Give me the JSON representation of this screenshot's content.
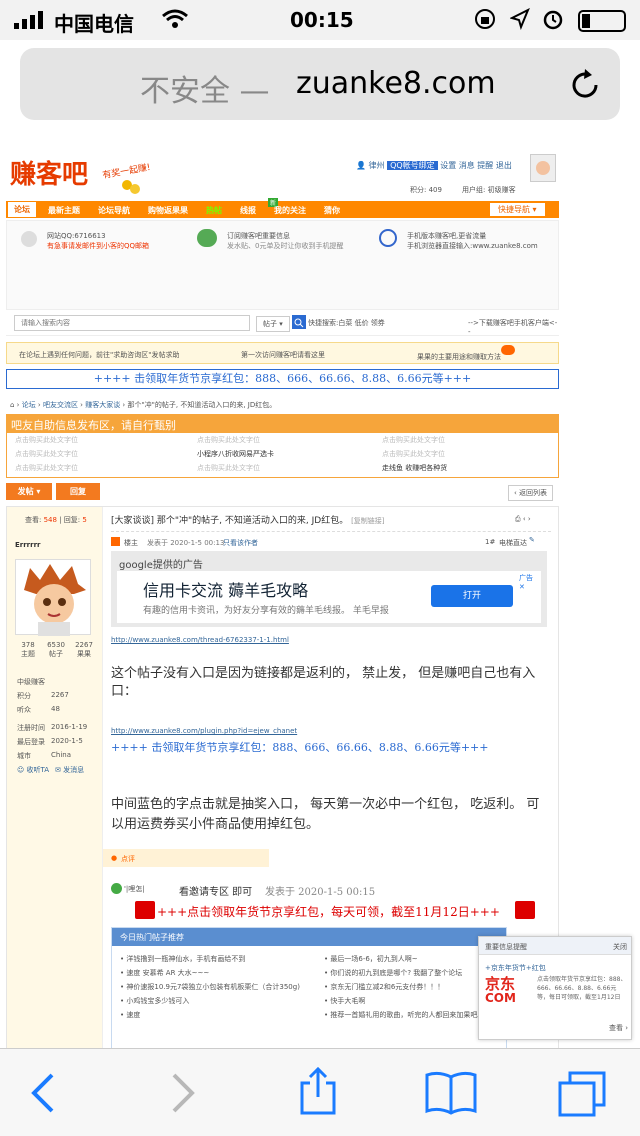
{
  "status": {
    "carrier": "中国电信",
    "time": "00:15"
  },
  "urlbar": {
    "insecure": "不安全 —",
    "domain": "zuanke8.com"
  },
  "site": {
    "logo": "赚客吧",
    "slogan": "有奖一起赚!",
    "user_links": [
      "律州",
      "QQ帐号绑定",
      "设置",
      "消息",
      "提醒",
      "退出"
    ],
    "points": "积分: 409",
    "user_group": "用户组: 初级赚客"
  },
  "nav": {
    "items": [
      "论坛",
      "最新主题",
      "论坛导航",
      "购物返果果",
      "热帖",
      "线报",
      "我的关注",
      "猜你"
    ],
    "badge": "新",
    "quick": "快捷导航"
  },
  "info": {
    "qq": "网站QQ:6716613",
    "qq_warn": "有急事请发邮件到小客的QQ邮箱",
    "wechat1": "订阅赚客吧重要信息",
    "wechat2": "发水贴、0元单及时让你收到手机提醒",
    "mobile1": "手机版本赚客吧,更省流量",
    "mobile2": "手机浏览器直接输入:www.zuanke8.com"
  },
  "search": {
    "placeholder": "请输入搜索内容",
    "type": "帖子",
    "hot": "快捷搜索:白菜 低价 领券",
    "app": "-->下载赚客吧手机客户端<--"
  },
  "notice": {
    "n1": "在论坛上遇到任何问题，前往\"求助咨询区\"发帖求助",
    "n2": "第一次访问赚客吧请看这里",
    "n3": "果果的主要用途和赚取方法"
  },
  "banner": "++++ 击领取年货节京享红包：888、666、66.66、8.88、6.66元等+++",
  "breadcrumb": [
    "论坛",
    "吧友交流区",
    "赚客大家谈",
    "那个\"冲\"的帖子,  不知道活动入口的来,  JD红包。"
  ],
  "adarea": {
    "title": "吧友自助信息发布区，请自行甄别",
    "placeholder": "点击购买此处文字位",
    "item1": "小程序八折收网易严选卡",
    "item2": "走线鱼 收赚吧各种货"
  },
  "buttons": {
    "post": "发帖",
    "reply": "回复",
    "back": "返回列表"
  },
  "thread": {
    "views_label": "查看:",
    "views": "548",
    "replies_label": "回复:",
    "replies": "5",
    "title": "[大家谈谈] 那个\"冲\"的帖子,  不知道活动入口的来,  JD红包。",
    "copy": "[复制链接]",
    "op_tag": "楼主",
    "posted": "发表于 2020-1-5 00:13",
    "only_author": "只看该作者",
    "floor": "1#",
    "dir": "电梯直达",
    "link1": "http://www.zuanke8.com/thread-6762337-1-1.html",
    "body1": "这个帖子没有入口是因为链接都是返利的，   禁止发，   但是赚吧自己也有入口：",
    "link2": "http://www.zuanke8.com/plugin.php?id=ejew_chanet",
    "body_banner": "++++ 击领取年货节京享红包：888、666、66.66、8.88、6.66元等+++",
    "body2": "中间蓝色的字点击就是抽奖入口，   每天第一次必中一个红包，   吃返利。   可以用运费券买小件商品使用掉红包。",
    "rate": "点评",
    "reply_user": "'|哩怎|",
    "reply_text": "看邀请专区 即可",
    "reply_time": "发表于 2020-1-5 00:15",
    "reply_banner": "+++点击领取年货节京享红包，每天可领，截至11月12日+++"
  },
  "profile": {
    "name": "Errrrrr",
    "stats": [
      [
        "378",
        "主题"
      ],
      [
        "6530",
        "帖子"
      ],
      [
        "2267",
        "果果"
      ]
    ],
    "level": "中级赚客",
    "rows": [
      [
        "积分",
        "2267"
      ],
      [
        "听众",
        "48"
      ],
      [
        "注册时间",
        "2016-1-19"
      ],
      [
        "最后登录",
        "2020-1-5"
      ],
      [
        "城市",
        "China"
      ]
    ],
    "follow": "收听TA",
    "msg": "发消息"
  },
  "ad": {
    "label": "google提供的广告",
    "title": "信用卡交流  薅羊毛攻略",
    "sub": "有趣的信用卡资讯，为好友分享有效的薅羊毛线报。 羊毛早报",
    "cta": "打开",
    "adx": "广告"
  },
  "hot": {
    "title": "今日热门帖子推荐",
    "left": [
      "洋钱撸到一瓶神仙水，手机有画给不到",
      "速度 安慕希 AR 大水~~~",
      "神价速报10.9元7袋独立小包装有机板栗仁（合计350g)",
      "小鸡钱宝多少钱可入",
      "速度"
    ],
    "right": [
      "最后一场6-6，初九到人啊~",
      "你们说的初九到底是哪个? 我翻了整个论坛",
      "京东无门槛立减2和6元支付券！！！",
      "快手大毛啊",
      "推荐一首婚礼用的歌曲，听完的人都回来加果吧。"
    ]
  },
  "popup": {
    "title": "重要信息提醒",
    "close": "关闭",
    "heading": "+京东年货节+红包",
    "text": "点击领取年货节京享红包：888、666、66.66、8.88、6.66元等，每日可领取，截至1月12日",
    "more": "查看",
    "brand": "京东"
  }
}
